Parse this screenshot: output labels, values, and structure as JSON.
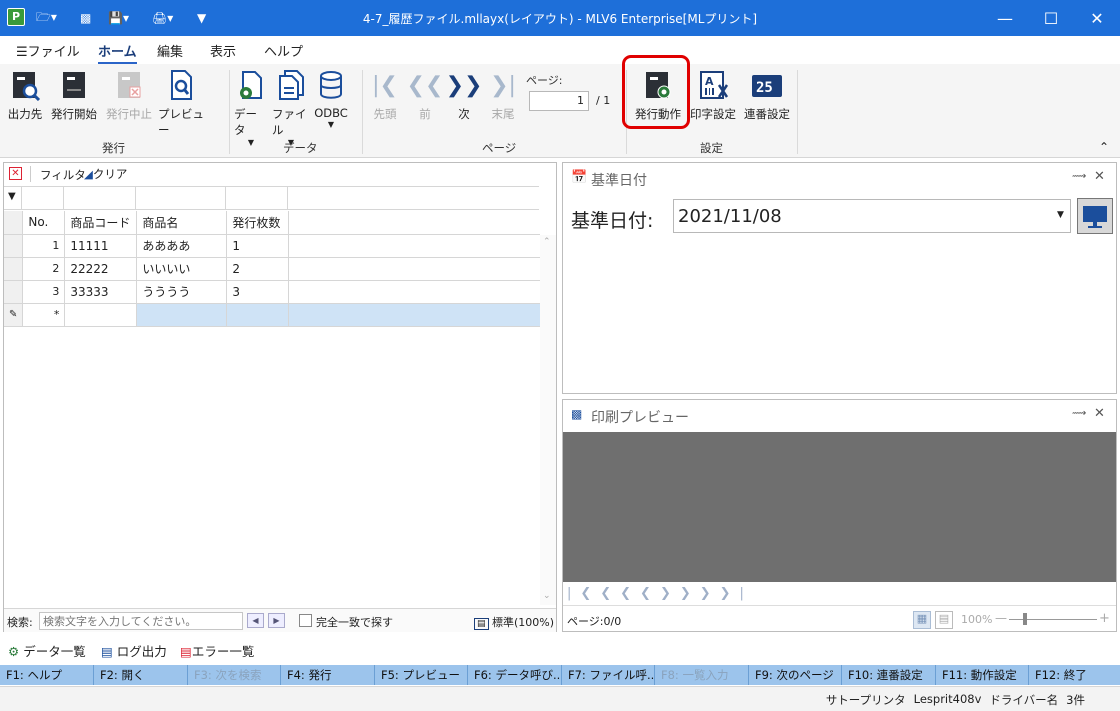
{
  "window": {
    "title": "4-7_履歴ファイル.mllayx(レイアウト) - MLV6 Enterprise[MLプリント]"
  },
  "menu": {
    "file": "ファイル",
    "home": "ホーム",
    "edit": "編集",
    "view": "表示",
    "help": "ヘルプ"
  },
  "ribbon": {
    "output_to": "出力先",
    "issue_start": "発行開始",
    "issue_stop": "発行中止",
    "preview": "プレビュー",
    "data": "データ",
    "file": "ファイル",
    "odbc": "ODBC",
    "first": "先頭",
    "prev": "前",
    "next": "次",
    "last": "末尾",
    "page_label": "ページ:",
    "page_value": "1",
    "page_total": "/ 1",
    "issue_action": "発行動作",
    "print_settings": "印字設定",
    "serial_settings": "連番設定",
    "group_issue": "発行",
    "group_data": "データ",
    "group_page": "ページ",
    "group_settings": "設定"
  },
  "grid": {
    "filter": "フィルタ",
    "clear": "クリア",
    "headers": [
      "No.",
      "商品コード",
      "商品名",
      "発行枚数"
    ],
    "rows": [
      {
        "no": "1",
        "code": "11111",
        "name": "ああああ",
        "qty": "1"
      },
      {
        "no": "2",
        "code": "22222",
        "name": "いいいい",
        "qty": "2"
      },
      {
        "no": "3",
        "code": "33333",
        "name": "うううう",
        "qty": "3"
      }
    ],
    "new_row_marker": "*",
    "search_label": "検索:",
    "search_placeholder": "検索文字を入力してください。",
    "exact_match": "完全一致で探す",
    "zoom": "標準(100%)"
  },
  "date_panel": {
    "title": "基準日付",
    "label": "基準日付:",
    "value": "2021/11/08"
  },
  "preview_panel": {
    "title": "印刷プレビュー",
    "page": "ページ:0/0",
    "zoom": "100%"
  },
  "bottom_tabs": {
    "data_list": "データ一覧",
    "log_output": "ログ出力",
    "error_list": "エラー一覧"
  },
  "fkeys": [
    {
      "label": "F1: ヘルプ",
      "enabled": true
    },
    {
      "label": "F2: 開く",
      "enabled": true
    },
    {
      "label": "F3: 次を検索",
      "enabled": false
    },
    {
      "label": "F4: 発行",
      "enabled": true
    },
    {
      "label": "F5: プレビュー",
      "enabled": true
    },
    {
      "label": "F6: データ呼び...",
      "enabled": true
    },
    {
      "label": "F7: ファイル呼...",
      "enabled": true
    },
    {
      "label": "F8: 一覧入力",
      "enabled": false
    },
    {
      "label": "F9: 次のページ",
      "enabled": true
    },
    {
      "label": "F10: 連番設定",
      "enabled": true
    },
    {
      "label": "F11: 動作設定",
      "enabled": true
    },
    {
      "label": "F12: 終了",
      "enabled": true
    }
  ],
  "status": {
    "printer": "サトープリンタ",
    "model": "Lesprit408v",
    "driver_label": "ドライバー名",
    "count": "3件"
  },
  "colors": {
    "titlebar": "#1e6fd9",
    "fkeys": "#9cc4ec",
    "highlight": "#e00000",
    "selected_row": "#cfe3f6"
  }
}
